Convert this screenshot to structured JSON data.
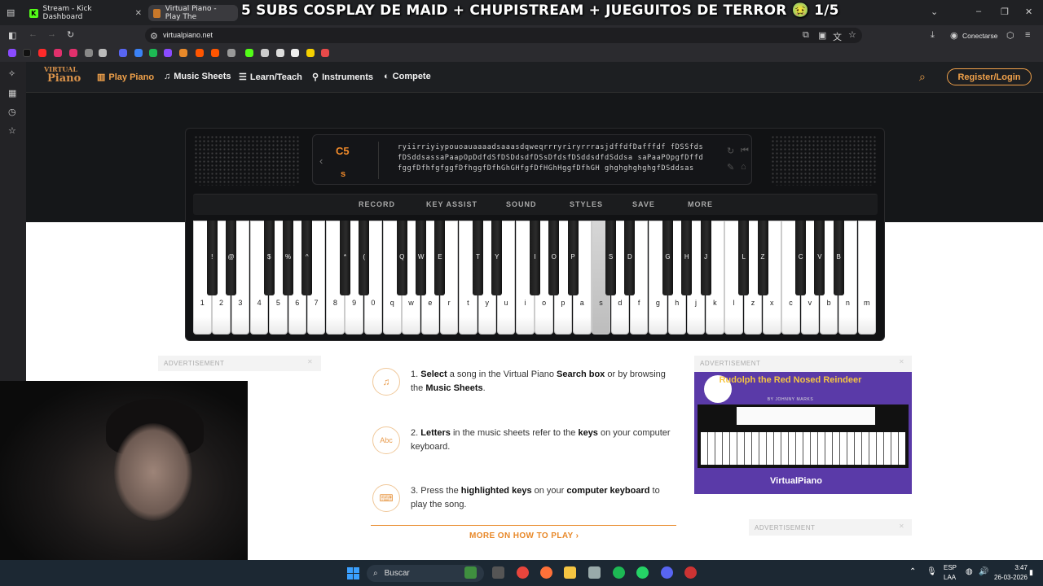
{
  "browser": {
    "tabs": [
      {
        "label": "Stream - Kick Dashboard"
      },
      {
        "label": "Virtual Piano - Play The"
      }
    ],
    "url": "virtualpiano.net",
    "connect_label": "Conectarse"
  },
  "stream_overlay": {
    "title": "5 SUBS COSPLAY DE MAID + CHUPISTREAM + JUEGUITOS DE TERROR 🤢 1/5"
  },
  "site": {
    "logo_line1": "VIRTUAL",
    "logo_line2": "Piano",
    "nav": [
      {
        "label": "Play Piano",
        "icon": "piano-icon"
      },
      {
        "label": "Music Sheets",
        "icon": "music-note-icon"
      },
      {
        "label": "Learn/Teach",
        "icon": "graduation-cap-icon"
      },
      {
        "label": "Instruments",
        "icon": "guitar-icon"
      },
      {
        "label": "Compete",
        "icon": "compete-icon"
      }
    ],
    "login_label": "Register/Login"
  },
  "piano": {
    "octave": "C5",
    "current_key": "s",
    "sheet_text": "ryiirriyiypouoauaaaadsaaasdqweqrrryriryrrrasjdffdfDafffdf fDSSfdsfDSddsassaPaapOpDdfdSfDSDdsdfDSsDfdsfDSddsdfdSddsa saPaaPOpgfDffdfggfDfhfgfggfDfhggfDfhGhGHfgfDfHGhHggfDfhGH ghghghghghgfDSddsas",
    "menu": [
      "RECORD",
      "KEY ASSIST",
      "SOUND",
      "STYLES",
      "SAVE",
      "MORE"
    ],
    "white_keys": [
      "1",
      "2",
      "3",
      "4",
      "5",
      "6",
      "7",
      "8",
      "9",
      "0",
      "q",
      "w",
      "e",
      "r",
      "t",
      "y",
      "u",
      "i",
      "o",
      "p",
      "a",
      "s",
      "d",
      "f",
      "g",
      "h",
      "j",
      "k",
      "l",
      "z",
      "x",
      "c",
      "v",
      "b",
      "n",
      "m"
    ],
    "black_keys": [
      {
        "label": "!",
        "after": 0
      },
      {
        "label": "@",
        "after": 1
      },
      {
        "label": "$",
        "after": 3
      },
      {
        "label": "%",
        "after": 4
      },
      {
        "label": "^",
        "after": 5
      },
      {
        "label": "*",
        "after": 7
      },
      {
        "label": "(",
        "after": 8
      },
      {
        "label": "Q",
        "after": 10
      },
      {
        "label": "W",
        "after": 11
      },
      {
        "label": "E",
        "after": 12
      },
      {
        "label": "T",
        "after": 14
      },
      {
        "label": "Y",
        "after": 15
      },
      {
        "label": "I",
        "after": 17
      },
      {
        "label": "O",
        "after": 18
      },
      {
        "label": "P",
        "after": 19
      },
      {
        "label": "S",
        "after": 21
      },
      {
        "label": "D",
        "after": 22
      },
      {
        "label": "G",
        "after": 24
      },
      {
        "label": "H",
        "after": 25
      },
      {
        "label": "J",
        "after": 26
      },
      {
        "label": "L",
        "after": 28
      },
      {
        "label": "Z",
        "after": 29
      },
      {
        "label": "C",
        "after": 31
      },
      {
        "label": "V",
        "after": 32
      },
      {
        "label": "B",
        "after": 33
      }
    ],
    "pressed_white_index": 21
  },
  "content": {
    "ad_label": "ADVERTISEMENT",
    "steps": [
      {
        "icon": "music-note-icon",
        "parts": [
          "1. ",
          "Select",
          " a song in the Virtual Piano ",
          "Search box",
          " or by browsing the ",
          "Music Sheets",
          "."
        ]
      },
      {
        "icon": "text-abc-icon",
        "parts": [
          "2. ",
          "Letters",
          " in the music sheets refer to the ",
          "keys",
          " on your computer keyboard.",
          "",
          ""
        ]
      },
      {
        "icon": "keyboard-icon",
        "parts": [
          "3. Press the ",
          "highlighted keys",
          " on your ",
          "computer keyboard",
          " to play the song.",
          "",
          ""
        ]
      }
    ],
    "more_link": "MORE ON HOW TO PLAY",
    "ad_card": {
      "title": "Rudolph the Red Nosed Reindeer",
      "byline": "BY JOHNNY MARKS",
      "brand": "VirtualPiano"
    }
  },
  "taskbar": {
    "search_placeholder": "Buscar",
    "lang_1": "ESP",
    "lang_2": "LAA",
    "time": "3:47",
    "date": "26-03-2026"
  }
}
